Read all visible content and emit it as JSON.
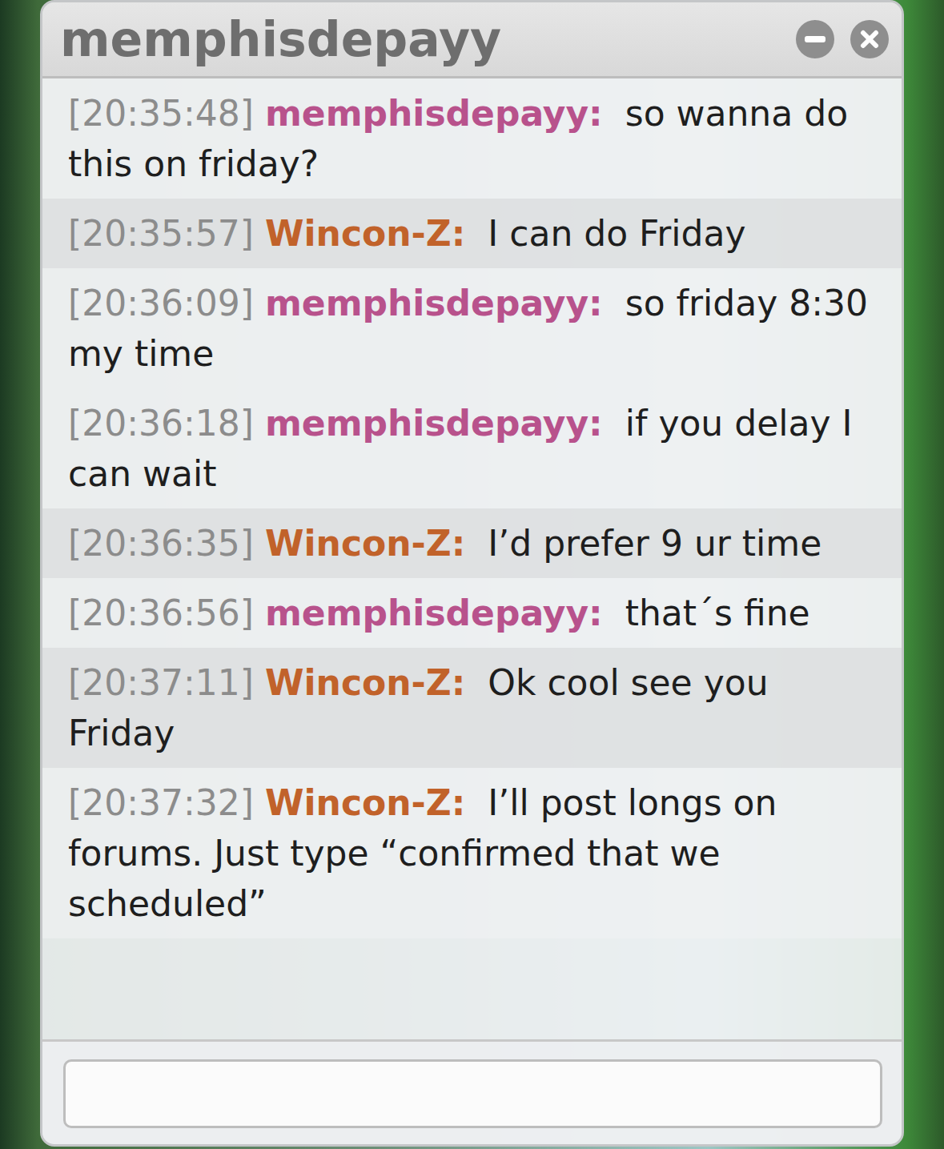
{
  "window": {
    "title": "memphisdepayy"
  },
  "messages": [
    {
      "time": "[20:35:48]",
      "sender": "memphisdepayy:",
      "text": "so wanna do this on friday?",
      "color": "#b8528c"
    },
    {
      "time": "[20:35:57]",
      "sender": "Wincon-Z:",
      "text": "I can do Friday",
      "color": "#c1622a"
    },
    {
      "time": "[20:36:09]",
      "sender": "memphisdepayy:",
      "text": "so friday 8:30 my time",
      "color": "#b8528c"
    },
    {
      "time": "[20:36:18]",
      "sender": "memphisdepayy:",
      "text": "if you delay I can wait",
      "color": "#b8528c"
    },
    {
      "time": "[20:36:35]",
      "sender": "Wincon-Z:",
      "text": "I’d prefer 9 ur time",
      "color": "#c1622a"
    },
    {
      "time": "[20:36:56]",
      "sender": "memphisdepayy:",
      "text": "that´s fine",
      "color": "#b8528c"
    },
    {
      "time": "[20:37:11]",
      "sender": "Wincon-Z:",
      "text": "Ok cool see you Friday",
      "color": "#c1622a"
    },
    {
      "time": "[20:37:32]",
      "sender": "Wincon-Z:",
      "text": "I’ll post longs on forums. Just type “confirmed that we scheduled”",
      "color": "#c1622a"
    }
  ],
  "input": {
    "value": ""
  }
}
